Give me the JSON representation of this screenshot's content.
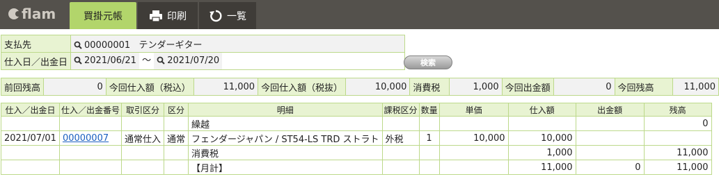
{
  "app": {
    "logo": "flam"
  },
  "tabs": [
    {
      "label": "買掛元帳",
      "icon": "ledger",
      "active": true
    },
    {
      "label": "印刷",
      "icon": "printer-icon"
    },
    {
      "label": "一覧",
      "icon": "back-arrow-icon"
    }
  ],
  "search": {
    "supplier_label": "支払先",
    "supplier_code": "00000001",
    "supplier_name": "テンダーギター",
    "date_label": "仕入日／出金日",
    "date_from": "2021/06/21",
    "range_sep": "〜",
    "date_to": "2021/07/20",
    "search_button": "検索"
  },
  "summary": {
    "prev_balance_label": "前回残高",
    "prev_balance": "0",
    "purchase_incl_label": "今回仕入額（税込）",
    "purchase_incl": "11,000",
    "purchase_excl_label": "今回仕入額（税抜）",
    "purchase_excl": "10,000",
    "tax_label": "消費税",
    "tax": "1,000",
    "payment_label": "今回出金額",
    "payment": "0",
    "balance_label": "今回残高",
    "balance": "11,000"
  },
  "detail": {
    "headers": [
      "仕入／出金日",
      "仕入／出金番号",
      "取引区分",
      "区分",
      "明細",
      "課税区分",
      "数量",
      "単価",
      "仕入額",
      "出金額",
      "残高"
    ],
    "rows": [
      {
        "date": "",
        "no": "",
        "type": "",
        "kbn": "",
        "desc": "繰越",
        "tax": "",
        "qty": "",
        "price": "",
        "purchase": "",
        "payment": "",
        "balance": "0"
      },
      {
        "date": "2021/07/01",
        "no": "00000007",
        "type": "通常仕入",
        "kbn": "通常",
        "desc": "フェンダージャパン / ST54-LS TRD ストラト",
        "tax": "外税",
        "qty": "1",
        "price": "10,000",
        "purchase": "10,000",
        "payment": "",
        "balance": ""
      },
      {
        "date": "",
        "no": "",
        "type": "",
        "kbn": "",
        "desc": "消費税",
        "tax": "",
        "qty": "",
        "price": "",
        "purchase": "1,000",
        "payment": "",
        "balance": "11,000"
      },
      {
        "date": "",
        "no": "",
        "type": "",
        "kbn": "",
        "desc": "【月計】",
        "tax": "",
        "qty": "",
        "price": "",
        "purchase": "11,000",
        "payment": "0",
        "balance": "11,000"
      }
    ]
  }
}
